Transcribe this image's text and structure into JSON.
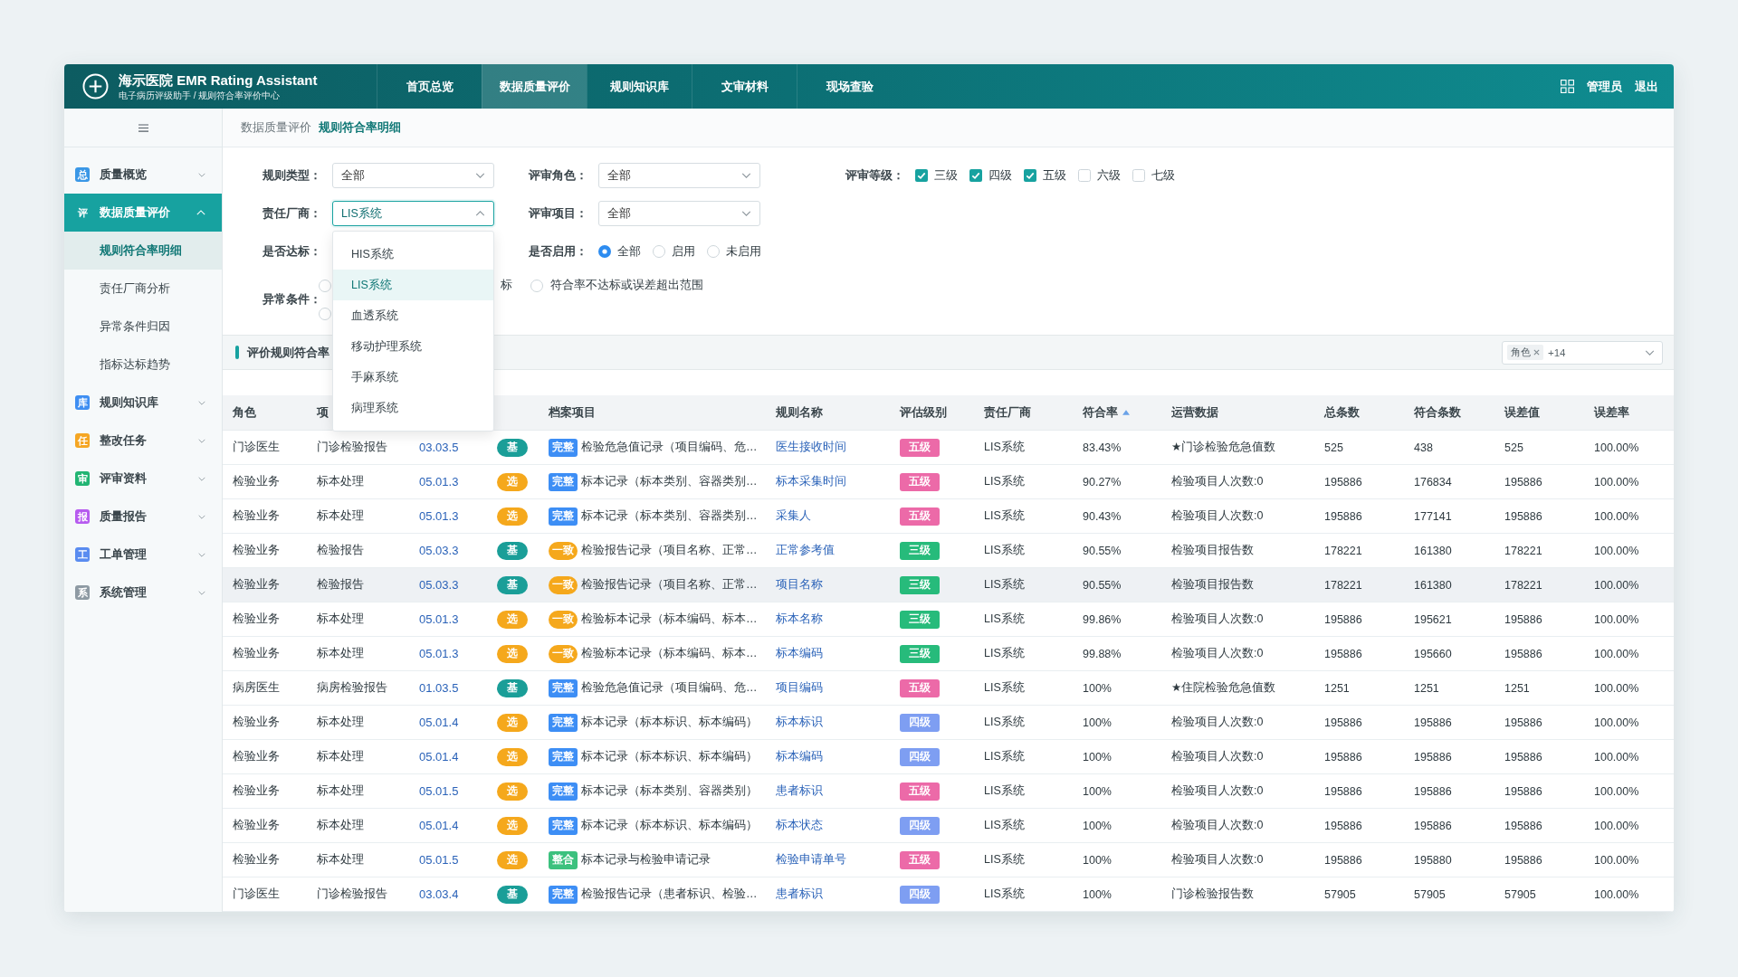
{
  "header": {
    "title": "海示医院 EMR Rating Assistant",
    "subtitle": "电子病历评级助手 / 规则符合率评价中心",
    "nav": [
      {
        "label": "首页总览",
        "selected": false
      },
      {
        "label": "数据质量评价",
        "selected": true
      },
      {
        "label": "规则知识库",
        "selected": false
      },
      {
        "label": "文审材料",
        "selected": false
      },
      {
        "label": "现场查验",
        "selected": false
      }
    ],
    "user": "管理员",
    "logout": "退出"
  },
  "sidebar": {
    "items": [
      {
        "tag": "总",
        "color": "#3a97e6",
        "label": "质量概览",
        "selected": false,
        "expanded": false
      },
      {
        "tag": "评",
        "color": "#17a2a0",
        "label": "数据质量评价",
        "selected": true,
        "expanded": true,
        "children": [
          {
            "label": "规则符合率明细",
            "selected": true
          },
          {
            "label": "责任厂商分析",
            "selected": false
          },
          {
            "label": "异常条件归因",
            "selected": false
          },
          {
            "label": "指标达标趋势",
            "selected": false
          }
        ]
      },
      {
        "tag": "库",
        "color": "#3e8ef2",
        "label": "规则知识库",
        "selected": false,
        "expanded": false
      },
      {
        "tag": "任",
        "color": "#f5a623",
        "label": "整改任务",
        "selected": false,
        "expanded": false
      },
      {
        "tag": "审",
        "color": "#22b573",
        "label": "评审资料",
        "selected": false,
        "expanded": false
      },
      {
        "tag": "报",
        "color": "#b65bef",
        "label": "质量报告",
        "selected": false,
        "expanded": false
      },
      {
        "tag": "工",
        "color": "#5a8cf0",
        "label": "工单管理",
        "selected": false,
        "expanded": false
      },
      {
        "tag": "系",
        "color": "#8e9aa3",
        "label": "系统管理",
        "selected": false,
        "expanded": false
      }
    ]
  },
  "breadcrumb": [
    {
      "label": "数据质量评价",
      "selected": false
    },
    {
      "label": "规则符合率明细",
      "selected": true
    }
  ],
  "filters": {
    "rule_type": {
      "label": "规则类型：",
      "value": "全部",
      "open": false
    },
    "review_role": {
      "label": "评审角色：",
      "value": "全部",
      "open": false
    },
    "review_level": {
      "label": "评审等级：",
      "options": [
        {
          "label": "三级",
          "checked": true
        },
        {
          "label": "四级",
          "checked": true
        },
        {
          "label": "五级",
          "checked": true
        },
        {
          "label": "六级",
          "checked": false
        },
        {
          "label": "七级",
          "checked": false
        }
      ]
    },
    "vendor": {
      "label": "责任厂商：",
      "value": "LIS系统",
      "open": true,
      "options": [
        {
          "label": "HIS系统",
          "selected": false
        },
        {
          "label": "LIS系统",
          "selected": true
        },
        {
          "label": "血透系统",
          "selected": false
        },
        {
          "label": "移动护理系统",
          "selected": false
        },
        {
          "label": "手麻系统",
          "selected": false
        },
        {
          "label": "病理系统",
          "selected": false
        }
      ]
    },
    "review_item": {
      "label": "评审项目：",
      "value": "全部",
      "open": false
    },
    "compliance": {
      "label": "是否达标："
    },
    "enabled": {
      "label": "是否启用：",
      "options": [
        {
          "label": "全部",
          "selected": true
        },
        {
          "label": "启用",
          "selected": false
        },
        {
          "label": "未启用",
          "selected": false
        }
      ]
    },
    "abnormal": {
      "label": "异常条件：",
      "options": [
        {
          "selected": false
        },
        {
          "label": "标"
        },
        {
          "label": "符合率不达标或误差超出范围",
          "selected": false
        },
        {
          "selected": false
        }
      ]
    }
  },
  "section": {
    "title": "评价规则符合率",
    "column_filter": {
      "tags": [
        {
          "label": "角色"
        }
      ],
      "more": "+14"
    }
  },
  "table": {
    "header": {
      "role": {
        "label": "角色",
        "sorted": false
      },
      "column_2": {
        "label": "项",
        "sorted": false
      },
      "record_item": {
        "label": "档案项目",
        "sorted": false
      },
      "rule_name": {
        "label": "规则名称",
        "sorted": false
      },
      "grade": {
        "label": "评估级别",
        "sorted": false
      },
      "vendor": {
        "label": "责任厂商",
        "sorted": false
      },
      "rate": {
        "label": "符合率",
        "sorted": true
      },
      "ops_data": {
        "label": "运营数据",
        "sorted": false
      },
      "total": {
        "label": "总条数",
        "sorted": false
      },
      "matched": {
        "label": "符合条数",
        "sorted": false
      },
      "error_value": {
        "label": "误差值",
        "sorted": false
      },
      "error_rate": {
        "label": "误差率",
        "sorted": false
      }
    },
    "rows": [
      {
        "hovered": false,
        "role": "门诊医生",
        "column_2": "门诊检验报告",
        "column_3": "03.03.5",
        "column_4": {
          "text": "基",
          "color": "#1a9e98"
        },
        "record_item": {
          "tag": {
            "text": "完整",
            "color": "#3d8ef5",
            "kind": "block"
          },
          "text": "检验危急值记录（项目编码、危…"
        },
        "rule_name": "医生接收时间",
        "grade": {
          "text": "五级",
          "color": "#ec6aa8"
        },
        "vendor": "LIS系统",
        "rate": "83.43%",
        "ops_data": "★门诊检验危急值数",
        "total": "525",
        "matched": "438",
        "error_value": "525",
        "error_rate": "100.00%"
      },
      {
        "hovered": false,
        "role": "检验业务",
        "column_2": "标本处理",
        "column_3": "05.01.3",
        "column_4": {
          "text": "选",
          "color": "#f5a81c"
        },
        "record_item": {
          "tag": {
            "text": "完整",
            "color": "#3d8ef5",
            "kind": "block"
          },
          "text": "标本记录（标本类别、容器类别…"
        },
        "rule_name": "标本采集时间",
        "grade": {
          "text": "五级",
          "color": "#ec6aa8"
        },
        "vendor": "LIS系统",
        "rate": "90.27%",
        "ops_data": "检验项目人次数:0",
        "total": "195886",
        "matched": "176834",
        "error_value": "195886",
        "error_rate": "100.00%"
      },
      {
        "hovered": false,
        "role": "检验业务",
        "column_2": "标本处理",
        "column_3": "05.01.3",
        "column_4": {
          "text": "选",
          "color": "#f5a81c"
        },
        "record_item": {
          "tag": {
            "text": "完整",
            "color": "#3d8ef5",
            "kind": "block"
          },
          "text": "标本记录（标本类别、容器类别…"
        },
        "rule_name": "采集人",
        "grade": {
          "text": "五级",
          "color": "#ec6aa8"
        },
        "vendor": "LIS系统",
        "rate": "90.43%",
        "ops_data": "检验项目人次数:0",
        "total": "195886",
        "matched": "177141",
        "error_value": "195886",
        "error_rate": "100.00%"
      },
      {
        "hovered": false,
        "role": "检验业务",
        "column_2": "检验报告",
        "column_3": "05.03.3",
        "column_4": {
          "text": "基",
          "color": "#1a9e98"
        },
        "record_item": {
          "tag": {
            "text": "一致",
            "color": "#f5a81c",
            "kind": "pill"
          },
          "text": "检验报告记录（项目名称、正常…"
        },
        "rule_name": "正常参考值",
        "grade": {
          "text": "三级",
          "color": "#27bb7b"
        },
        "vendor": "LIS系统",
        "rate": "90.55%",
        "ops_data": "检验项目报告数",
        "total": "178221",
        "matched": "161380",
        "error_value": "178221",
        "error_rate": "100.00%"
      },
      {
        "hovered": true,
        "role": "检验业务",
        "column_2": "检验报告",
        "column_3": "05.03.3",
        "column_4": {
          "text": "基",
          "color": "#1a9e98"
        },
        "record_item": {
          "tag": {
            "text": "一致",
            "color": "#f5a81c",
            "kind": "pill"
          },
          "text": "检验报告记录（项目名称、正常…"
        },
        "rule_name": "项目名称",
        "grade": {
          "text": "三级",
          "color": "#27bb7b"
        },
        "vendor": "LIS系统",
        "rate": "90.55%",
        "ops_data": "检验项目报告数",
        "total": "178221",
        "matched": "161380",
        "error_value": "178221",
        "error_rate": "100.00%"
      },
      {
        "hovered": false,
        "role": "检验业务",
        "column_2": "标本处理",
        "column_3": "05.01.3",
        "column_4": {
          "text": "选",
          "color": "#f5a81c"
        },
        "record_item": {
          "tag": {
            "text": "一致",
            "color": "#f5a81c",
            "kind": "pill"
          },
          "text": "检验标本记录（标本编码、标本…"
        },
        "rule_name": "标本名称",
        "grade": {
          "text": "三级",
          "color": "#27bb7b"
        },
        "vendor": "LIS系统",
        "rate": "99.86%",
        "ops_data": "检验项目人次数:0",
        "total": "195886",
        "matched": "195621",
        "error_value": "195886",
        "error_rate": "100.00%"
      },
      {
        "hovered": false,
        "role": "检验业务",
        "column_2": "标本处理",
        "column_3": "05.01.3",
        "column_4": {
          "text": "选",
          "color": "#f5a81c"
        },
        "record_item": {
          "tag": {
            "text": "一致",
            "color": "#f5a81c",
            "kind": "pill"
          },
          "text": "检验标本记录（标本编码、标本…"
        },
        "rule_name": "标本编码",
        "grade": {
          "text": "三级",
          "color": "#27bb7b"
        },
        "vendor": "LIS系统",
        "rate": "99.88%",
        "ops_data": "检验项目人次数:0",
        "total": "195886",
        "matched": "195660",
        "error_value": "195886",
        "error_rate": "100.00%"
      },
      {
        "hovered": false,
        "role": "病房医生",
        "column_2": "病房检验报告",
        "column_3": "01.03.5",
        "column_4": {
          "text": "基",
          "color": "#1a9e98"
        },
        "record_item": {
          "tag": {
            "text": "完整",
            "color": "#3d8ef5",
            "kind": "block"
          },
          "text": "检验危急值记录（项目编码、危…"
        },
        "rule_name": "项目编码",
        "grade": {
          "text": "五级",
          "color": "#ec6aa8"
        },
        "vendor": "LIS系统",
        "rate": "100%",
        "ops_data": "★住院检验危急值数",
        "total": "1251",
        "matched": "1251",
        "error_value": "1251",
        "error_rate": "100.00%"
      },
      {
        "hovered": false,
        "role": "检验业务",
        "column_2": "标本处理",
        "column_3": "05.01.4",
        "column_4": {
          "text": "选",
          "color": "#f5a81c"
        },
        "record_item": {
          "tag": {
            "text": "完整",
            "color": "#3d8ef5",
            "kind": "block"
          },
          "text": "标本记录（标本标识、标本编码）"
        },
        "rule_name": "标本标识",
        "grade": {
          "text": "四级",
          "color": "#7e9ef2"
        },
        "vendor": "LIS系统",
        "rate": "100%",
        "ops_data": "检验项目人次数:0",
        "total": "195886",
        "matched": "195886",
        "error_value": "195886",
        "error_rate": "100.00%"
      },
      {
        "hovered": false,
        "role": "检验业务",
        "column_2": "标本处理",
        "column_3": "05.01.4",
        "column_4": {
          "text": "选",
          "color": "#f5a81c"
        },
        "record_item": {
          "tag": {
            "text": "完整",
            "color": "#3d8ef5",
            "kind": "block"
          },
          "text": "标本记录（标本标识、标本编码）"
        },
        "rule_name": "标本编码",
        "grade": {
          "text": "四级",
          "color": "#7e9ef2"
        },
        "vendor": "LIS系统",
        "rate": "100%",
        "ops_data": "检验项目人次数:0",
        "total": "195886",
        "matched": "195886",
        "error_value": "195886",
        "error_rate": "100.00%"
      },
      {
        "hovered": false,
        "role": "检验业务",
        "column_2": "标本处理",
        "column_3": "05.01.5",
        "column_4": {
          "text": "选",
          "color": "#f5a81c"
        },
        "record_item": {
          "tag": {
            "text": "完整",
            "color": "#3d8ef5",
            "kind": "block"
          },
          "text": "标本记录（标本类别、容器类别）"
        },
        "rule_name": "患者标识",
        "grade": {
          "text": "五级",
          "color": "#ec6aa8"
        },
        "vendor": "LIS系统",
        "rate": "100%",
        "ops_data": "检验项目人次数:0",
        "total": "195886",
        "matched": "195886",
        "error_value": "195886",
        "error_rate": "100.00%"
      },
      {
        "hovered": false,
        "role": "检验业务",
        "column_2": "标本处理",
        "column_3": "05.01.4",
        "column_4": {
          "text": "选",
          "color": "#f5a81c"
        },
        "record_item": {
          "tag": {
            "text": "完整",
            "color": "#3d8ef5",
            "kind": "block"
          },
          "text": "标本记录（标本标识、标本编码）"
        },
        "rule_name": "标本状态",
        "grade": {
          "text": "四级",
          "color": "#7e9ef2"
        },
        "vendor": "LIS系统",
        "rate": "100%",
        "ops_data": "检验项目人次数:0",
        "total": "195886",
        "matched": "195886",
        "error_value": "195886",
        "error_rate": "100.00%"
      },
      {
        "hovered": false,
        "role": "检验业务",
        "column_2": "标本处理",
        "column_3": "05.01.5",
        "column_4": {
          "text": "选",
          "color": "#f5a81c"
        },
        "record_item": {
          "tag": {
            "text": "整合",
            "color": "#3cc17e",
            "kind": "block"
          },
          "text": "标本记录与检验申请记录"
        },
        "rule_name": "检验申请单号",
        "grade": {
          "text": "五级",
          "color": "#ec6aa8"
        },
        "vendor": "LIS系统",
        "rate": "100%",
        "ops_data": "检验项目人次数:0",
        "total": "195886",
        "matched": "195880",
        "error_value": "195886",
        "error_rate": "100.00%"
      },
      {
        "hovered": false,
        "role": "门诊医生",
        "column_2": "门诊检验报告",
        "column_3": "03.03.4",
        "column_4": {
          "text": "基",
          "color": "#1a9e98"
        },
        "record_item": {
          "tag": {
            "text": "完整",
            "color": "#3d8ef5",
            "kind": "block"
          },
          "text": "检验报告记录（患者标识、检验…"
        },
        "rule_name": "患者标识",
        "grade": {
          "text": "四级",
          "color": "#7e9ef2"
        },
        "vendor": "LIS系统",
        "rate": "100%",
        "ops_data": "门诊检验报告数",
        "total": "57905",
        "matched": "57905",
        "error_value": "57905",
        "error_rate": "100.00%"
      }
    ]
  }
}
